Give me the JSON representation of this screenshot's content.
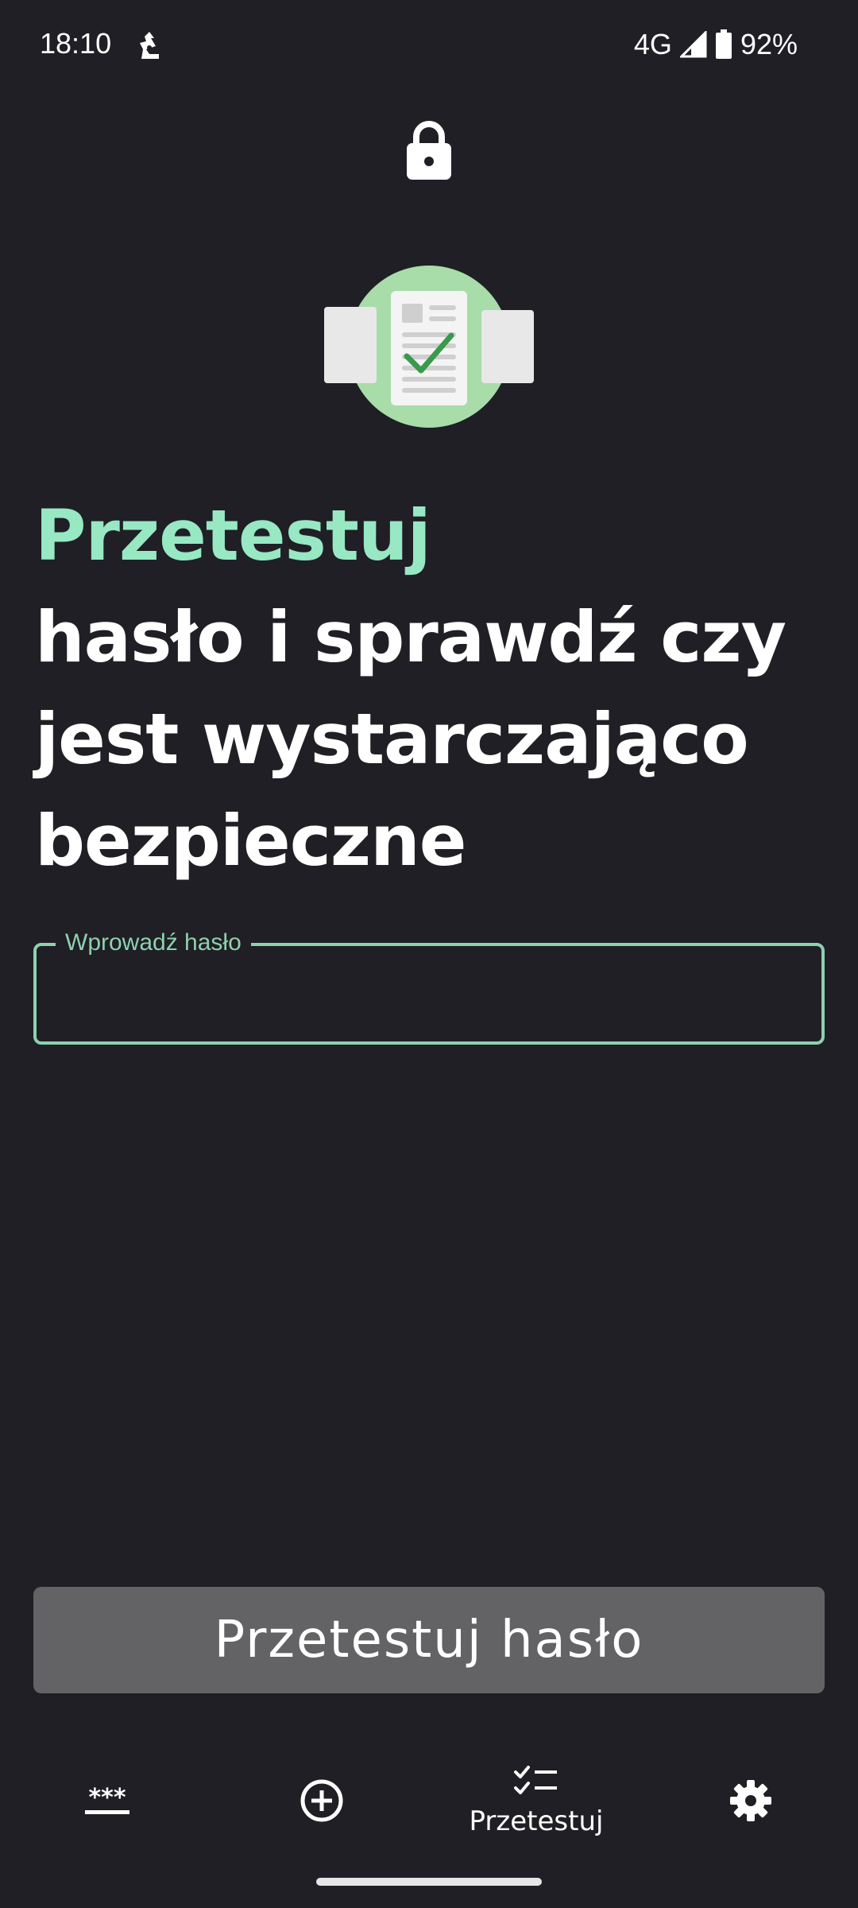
{
  "status_bar": {
    "time": "18:10",
    "network": "4G",
    "battery": "92%",
    "notification_icon": "app-notification-icon",
    "signal_icon": "signal-icon",
    "battery_icon": "battery-icon"
  },
  "header": {
    "icon": "lock-icon"
  },
  "illustration": {
    "icon": "password-check-illustration"
  },
  "headline": {
    "accent": "Przetestuj",
    "line1": "hasło i sprawdź czy",
    "line2": "jest wystarczająco",
    "line3": "bezpieczne"
  },
  "password_input": {
    "label": "Wprowadź hasło",
    "value": "",
    "placeholder": ""
  },
  "primary_action": {
    "label": "Przetestuj hasło"
  },
  "bottom_nav": {
    "items": [
      {
        "icon": "password-dots-icon",
        "label": "",
        "active": false
      },
      {
        "icon": "add-circle-icon",
        "label": "",
        "active": false
      },
      {
        "icon": "checklist-icon",
        "label": "Przetestuj",
        "active": true
      },
      {
        "icon": "settings-gear-icon",
        "label": "",
        "active": false
      }
    ]
  },
  "colors": {
    "background": "#1f1f25",
    "accent": "#97e8c3",
    "input_border": "#8fd0ae",
    "button_bg": "#636365",
    "illustration_circle": "#a8dca9",
    "check_green": "#3a9a4c"
  }
}
